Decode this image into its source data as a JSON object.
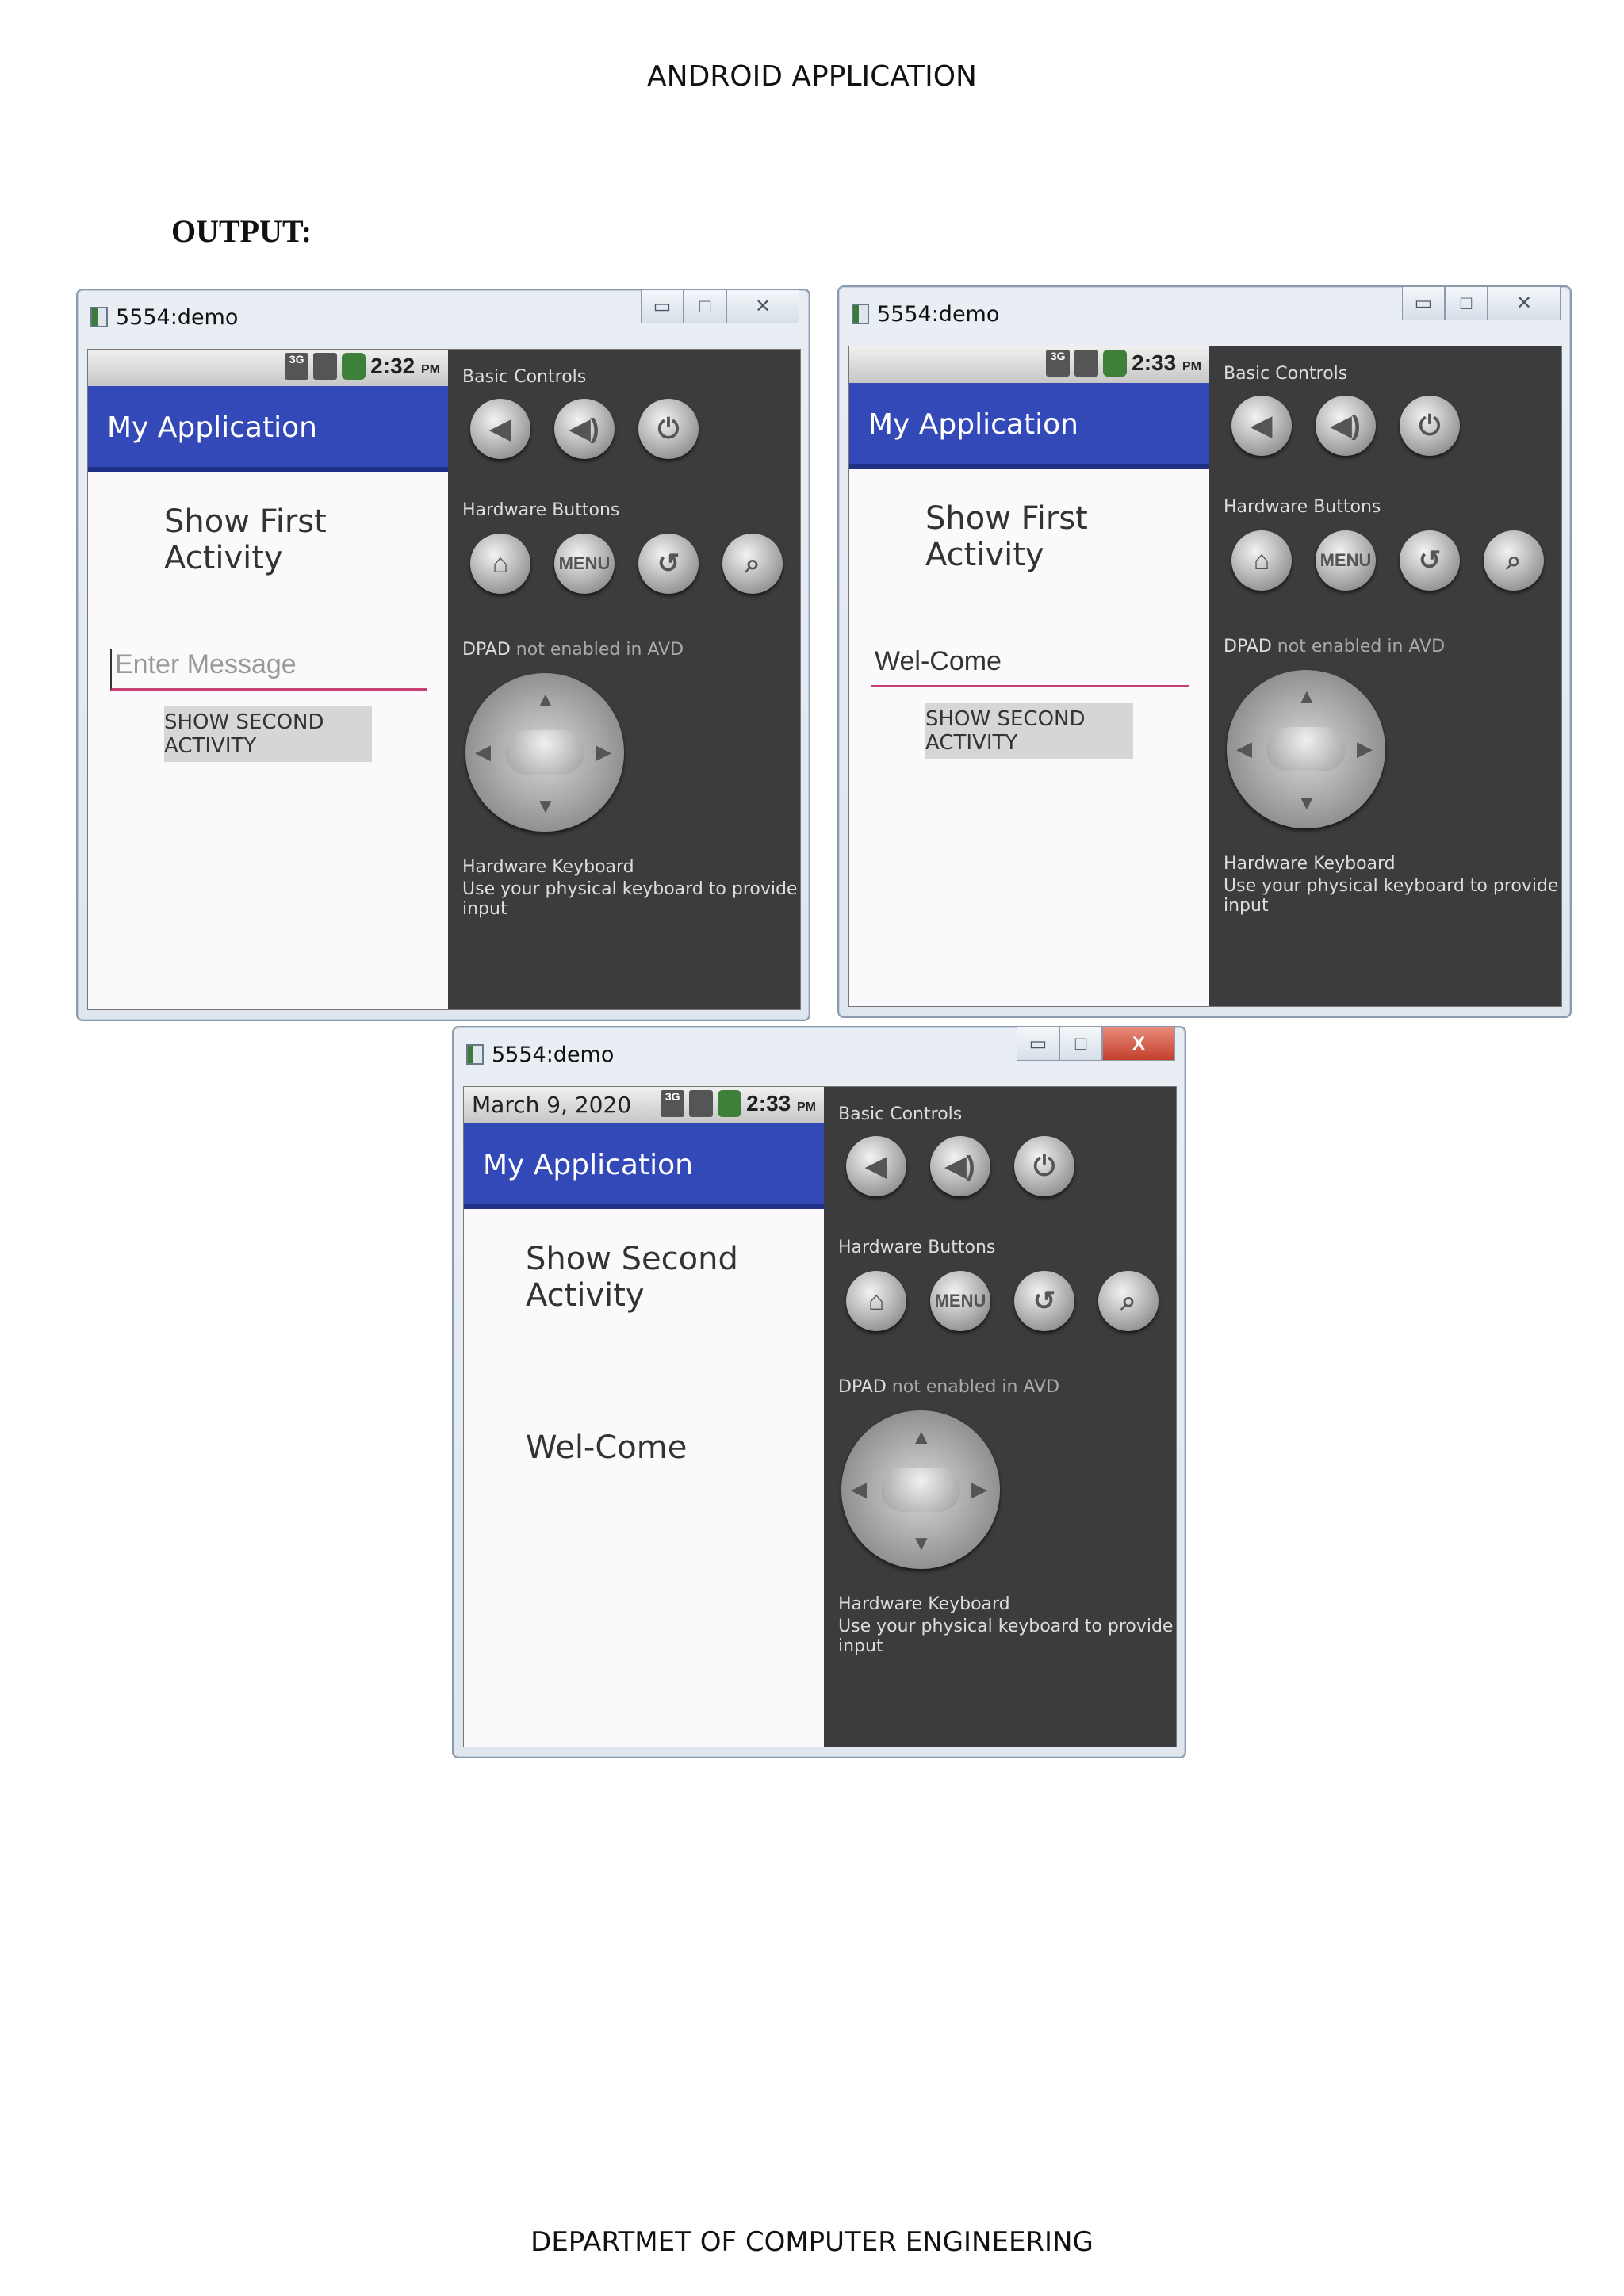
{
  "page": {
    "header": "ANDROID APPLICATION",
    "section_label": "OUTPUT:",
    "footer": "DEPARTMET OF COMPUTER ENGINEERING"
  },
  "colors": {
    "app_bar": "#3349b8",
    "input_underline": "#c64072",
    "controls_panel": "#3c3c3e",
    "battery": "#3e7f3a",
    "close_button": "#c2402c"
  },
  "icons": {
    "volume_down": "volume-down-icon",
    "volume_up": "volume-up-icon",
    "power": "power-icon",
    "home": "home-icon",
    "back": "back-icon",
    "search": "search-icon"
  },
  "windows": [
    {
      "title": "5554:demo",
      "status": {
        "date": "",
        "network": "3G",
        "time": "2:32",
        "ampm": "PM"
      },
      "app_title": "My Application",
      "heading": "Show First Activity",
      "input": {
        "value": "",
        "placeholder": "Enter Message"
      },
      "button_label": "SHOW SECOND ACTIVITY",
      "message": ""
    },
    {
      "title": "5554:demo",
      "status": {
        "date": "",
        "network": "3G",
        "time": "2:33",
        "ampm": "PM"
      },
      "app_title": "My Application",
      "heading": "Show First Activity",
      "input": {
        "value": "Wel-Come",
        "placeholder": ""
      },
      "button_label": "SHOW SECOND ACTIVITY",
      "message": ""
    },
    {
      "title": "5554:demo",
      "status": {
        "date": "March 9, 2020",
        "network": "3G",
        "time": "2:33",
        "ampm": "PM"
      },
      "app_title": "My Application",
      "heading": "Show Second Activity",
      "input": null,
      "button_label": "",
      "message": "Wel-Come"
    }
  ],
  "controls": {
    "basic_controls": "Basic Controls",
    "hardware_buttons": "Hardware Buttons",
    "menu_label": "MENU",
    "dpad_label": "DPAD",
    "dpad_note": "not enabled in AVD",
    "keyboard_title": "Hardware Keyboard",
    "keyboard_desc": "Use your physical keyboard to provide input"
  },
  "window_controls": {
    "minimize": "▭",
    "maximize": "□",
    "close_plain": "✕",
    "close_active": "X"
  }
}
